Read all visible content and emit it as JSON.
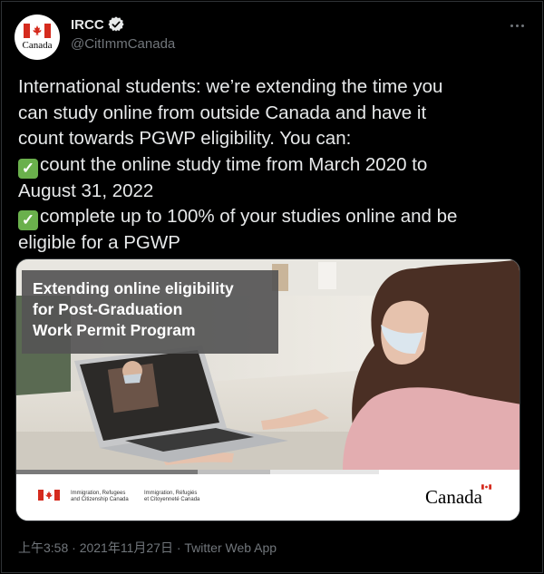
{
  "tweet": {
    "author": {
      "avatar_text": "Canada",
      "display_name": "IRCC",
      "verified_icon": "verified-badge-icon",
      "handle": "@CitImmCanada"
    },
    "more_icon": "more-options-icon",
    "text_lines": [
      "International students: we’re extending the time you",
      "can study online from outside Canada and have it",
      "count towards PGWP eligibility. You can:",
      "count the online study time from March 2020 to",
      "August 31, 2022",
      "complete up to 100% of your studies online and be",
      "eligible for a PGWP"
    ],
    "check_icon": "✓",
    "media": {
      "headline_lines": [
        "Extending online eligibility",
        "for Post-Graduation",
        "Work Permit Program"
      ],
      "gov_en": [
        "Immigration, Refugees",
        "and Citizenship Canada"
      ],
      "gov_fr": [
        "Immigration, Réfugiés",
        "et Citoyenneté Canada"
      ],
      "wordmark": "Canada"
    },
    "meta": "上午3:58 · 2021年11月27日 · Twitter Web App"
  },
  "colors": {
    "background": "#000000",
    "text": "#e7e9ea",
    "muted": "#71767b",
    "canada_red": "#d52b1e",
    "check_green": "#6ab04c"
  }
}
